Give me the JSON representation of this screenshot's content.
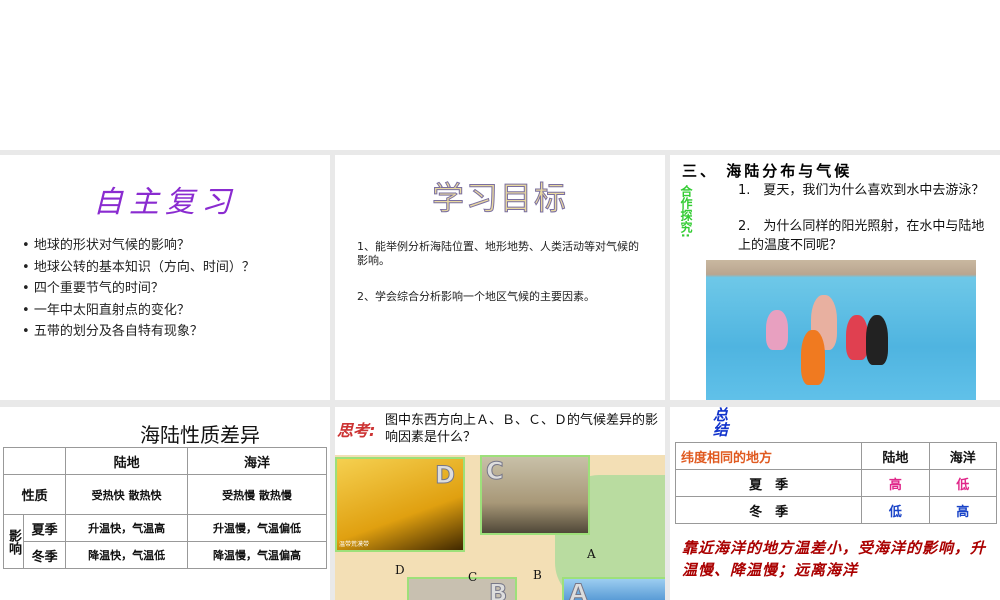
{
  "slides": [
    {
      "title": "自主复习",
      "bullets": [
        "地球的形状对气候的影响？",
        "地球公转的基本知识（方向、时间）？",
        "四个重要节气的时间？",
        "一年中太阳直射点的变化？",
        "五带的划分及各自特有现象？"
      ]
    },
    {
      "title": "学习目标",
      "objectives": [
        "1、能举例分析海陆位置、地形地势、人类活动等对气候的影响。",
        "2、学会综合分析影响一个地区气候的主要因素。"
      ]
    },
    {
      "title": "三、 海陆分布与气候",
      "side_label": "合作探究:",
      "questions": [
        "1.　夏天，我们为什么喜欢到水中去游泳？",
        "2.　为什么同样的阳光照射，在水中与陆地上的温度不同呢？"
      ]
    },
    {
      "title": "海陆性质差异",
      "table": {
        "headers": [
          "",
          "陆地",
          "海洋"
        ],
        "rows": [
          [
            "性质",
            "受热快 散热快",
            "受热慢 散热慢"
          ],
          [
            "影响",
            "夏季",
            "升温快，气温高",
            "升温慢，气温偏低"
          ],
          [
            "",
            "冬季",
            "降温快，气温低",
            "降温慢，气温偏高"
          ]
        ]
      }
    },
    {
      "think_label": "思考:",
      "question": "图中东西方向上Ａ、Ｂ、Ｃ、Ｄ的气候差异的影响因素是什么？",
      "photo_labels": [
        "D",
        "C",
        "B",
        "A"
      ],
      "map_labels": [
        "D",
        "C",
        "B",
        "A"
      ],
      "caption": "温带荒漠带"
    },
    {
      "side_label": "总结",
      "table": {
        "headers": [
          "纬度相同的地方",
          "陆地",
          "海洋"
        ],
        "rows": [
          [
            "夏　季",
            "高",
            "低"
          ],
          [
            "冬　季",
            "低",
            "高"
          ]
        ]
      },
      "summary": "靠近海洋的地方温差小，受海洋的影响，升温慢、降温慢；远离海洋"
    }
  ],
  "colors": {
    "high": "#e0288a",
    "low": "#1a44c8",
    "accent_red": "#a00000",
    "header_orange": "#e05a20"
  }
}
